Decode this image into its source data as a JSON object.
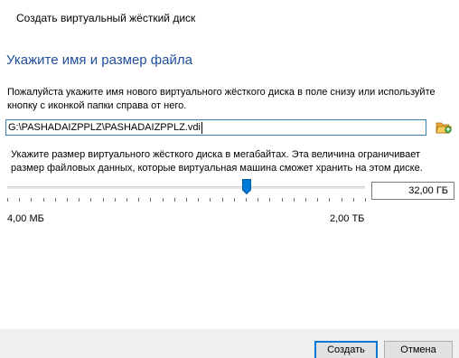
{
  "window": {
    "title": "Создать виртуальный жёсткий диск"
  },
  "section": {
    "heading": "Укажите имя и размер файла",
    "location_hint_line1": "Пожалуйста укажите имя нового виртуального жёсткого диска в поле снизу или используйте",
    "location_hint_line2": "кнопку с иконкой папки справа от него.",
    "file_path": "G:\\PASHADAIZPPLZ\\PASHADAIZPPLZ.vdi",
    "size_hint_line1": "Укажите размер виртуального жёсткого диска в мегабайтах. Эта величина ограничивает",
    "size_hint_line2": "размер файловых данных, которые виртуальная машина сможет хранить на этом диске."
  },
  "size": {
    "value": "32,00 ГБ",
    "min_label": "4,00 МБ",
    "max_label": "2,00 ТБ",
    "slider_fraction": 0.67
  },
  "buttons": {
    "create": "Создать",
    "cancel": "Отмена"
  },
  "icons": {
    "folder_button": "folder-open-icon",
    "slider_thumb": "slider-thumb-icon"
  },
  "colors": {
    "heading": "#1f4e9c",
    "accent": "#0078d7",
    "footer": "#f0f0f0"
  }
}
